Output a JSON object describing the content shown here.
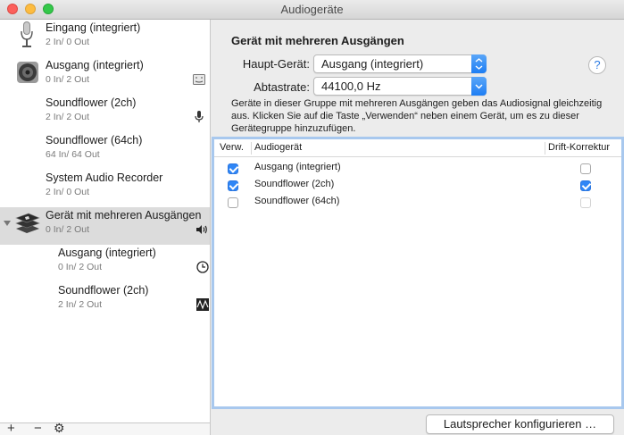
{
  "window": {
    "title": "Audiogeräte"
  },
  "sidebar": {
    "devices": [
      {
        "name": "Eingang (integriert)",
        "io": "2 In/ 0 Out"
      },
      {
        "name": "Ausgang (integriert)",
        "io": "0 In/ 2 Out"
      },
      {
        "name": "Soundflower (2ch)",
        "io": "2 In/ 2 Out"
      },
      {
        "name": "Soundflower (64ch)",
        "io": "64 In/ 64 Out"
      },
      {
        "name": "System Audio Recorder",
        "io": "2 In/ 0 Out"
      },
      {
        "name": "Gerät mit mehreren Ausgängen",
        "io": "0 In/ 2 Out"
      },
      {
        "name": "Ausgang (integriert)",
        "io": "0 In/ 2 Out"
      },
      {
        "name": "Soundflower (2ch)",
        "io": "2 In/ 2 Out"
      }
    ],
    "add": "+",
    "remove": "−",
    "gear": "⚙"
  },
  "panel": {
    "group_title": "Gerät mit mehreren Ausgängen",
    "main_device_label": "Haupt-Gerät:",
    "main_device_value": "Ausgang (integriert)",
    "sample_rate_label": "Abtastrate:",
    "sample_rate_value": "44100,0 Hz",
    "help": "?",
    "description": "Geräte in dieser Gruppe mit mehreren Ausgängen geben das Audiosignal gleichzeitig aus. Klicken Sie auf die Taste „Verwenden“ neben einem Gerät, um es zu dieser Gerätegruppe hinzuzufügen.",
    "table": {
      "col_use": "Verw.",
      "col_device": "Audiogerät",
      "col_drift": "Drift-Korrektur",
      "rows": [
        {
          "device": "Ausgang (integriert)",
          "use": true,
          "drift": false
        },
        {
          "device": "Soundflower (2ch)",
          "use": true,
          "drift": true
        },
        {
          "device": "Soundflower (64ch)",
          "use": false,
          "drift": false
        }
      ]
    },
    "configure_button": "Lautsprecher konfigurieren …"
  }
}
